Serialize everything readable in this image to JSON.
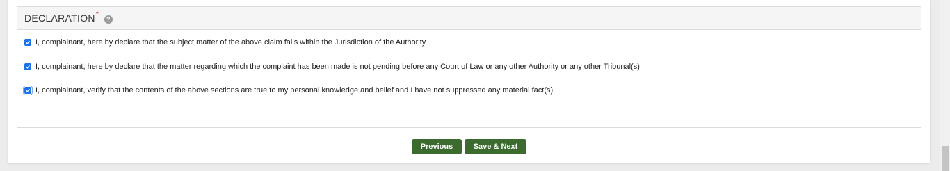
{
  "declaration": {
    "title": "DECLARATION",
    "required_marker": "*",
    "help_icon_glyph": "?",
    "items": [
      {
        "checked": true,
        "text": "I, complainant, here by declare that the subject matter of the above claim falls within the Jurisdiction of the Authority"
      },
      {
        "checked": true,
        "text": "I, complainant, here by declare that the matter regarding which the complaint has been made is not pending before any Court of Law or any other Authority or any other Tribunal(s)"
      },
      {
        "checked": true,
        "text": "I, complainant, verify that the contents of the above sections are true to my personal knowledge and belief and I have not suppressed any material fact(s)"
      }
    ]
  },
  "buttons": {
    "previous_label": "Previous",
    "save_next_label": "Save & Next"
  },
  "colors": {
    "button_green": "#3b6b2f",
    "checkbox_blue": "#1a73e8",
    "required_red": "#d32f2f"
  }
}
